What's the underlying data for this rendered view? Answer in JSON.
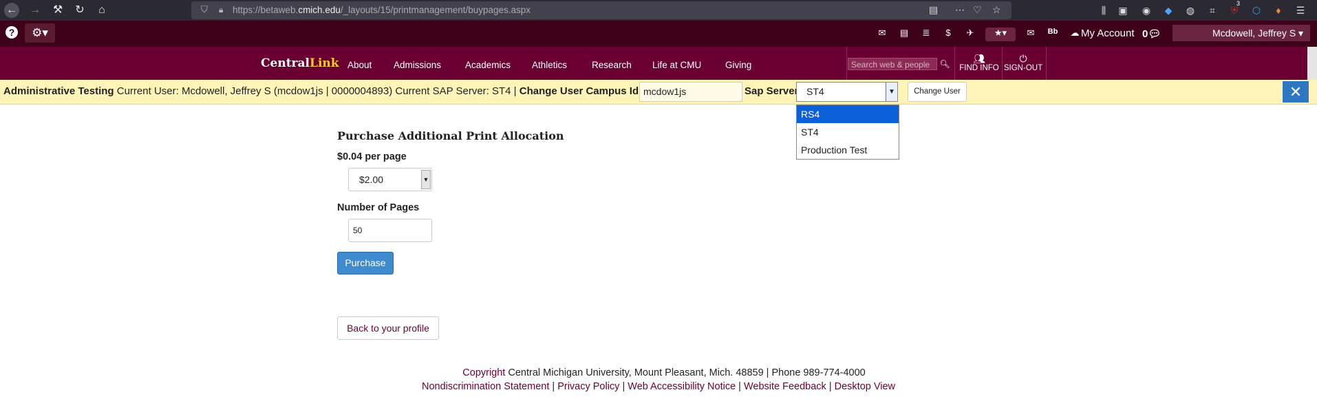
{
  "browser": {
    "url_prefix": "https://betaweb.",
    "url_domain": "cmich.edu",
    "url_path": "/_layouts/15/printmanagement/buypages.aspx",
    "addon_badge": "3"
  },
  "util_bar": {
    "my_account": "My Account",
    "notif_count": "0",
    "user_name": "Mcdowell, Jeffrey S"
  },
  "nav": {
    "logo_main": "Central",
    "logo_accent": "Link",
    "items": [
      "About",
      "Admissions",
      "Academics",
      "Athletics",
      "Research",
      "Life at CMU",
      "Giving"
    ],
    "search_placeholder": "Search web & people",
    "find_info": "FIND INFO",
    "sign_out": "SIGN-OUT"
  },
  "admin_bar": {
    "label": "Administrative Testing",
    "current_user_text": " Current User: Mcdowell, Jeffrey S (mcdow1js | 0000004893) Current SAP Server: ST4 | ",
    "change_user_label": "Change User Campus Id / Global ID",
    "campus_id_value": "mcdow1js",
    "sap_label": "Sap Server",
    "sap_selected": "ST4",
    "sap_options": [
      "RS4",
      "ST4",
      "Production Test"
    ],
    "change_user_button": "Change User"
  },
  "content": {
    "title": "Purchase Additional Print Allocation",
    "price_label": "$0.04 per page",
    "amount_value": "$2.00",
    "pages_label": "Number of Pages",
    "pages_value": "50",
    "purchase_button": "Purchase",
    "back_button": "Back to your profile"
  },
  "footer": {
    "copyright": "Copyright",
    "address": " Central Michigan University, Mount Pleasant, Mich. 48859 | Phone 989-774-4000",
    "links": [
      "Nondiscrimination Statement",
      "Privacy Policy",
      "Web Accessibility Notice",
      "Website Feedback",
      "Desktop View"
    ]
  }
}
